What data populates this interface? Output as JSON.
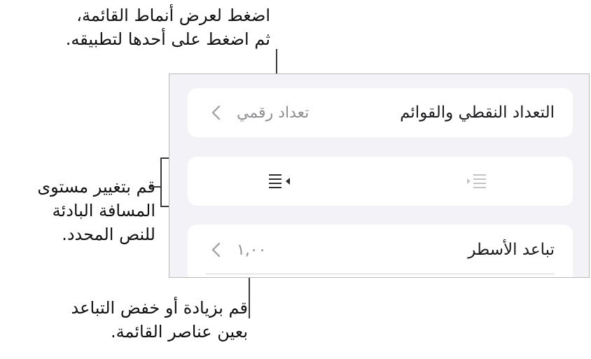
{
  "callouts": {
    "top": {
      "line1": "اضغط لعرض أنماط القائمة،",
      "line2": "ثم اضغط على أحدها لتطبيقه."
    },
    "left": {
      "line1": "قم بتغيير مستوى",
      "line2": "المسافة البادئة",
      "line3": "للنص المحدد."
    },
    "bottom": {
      "line1": "قم بزيادة أو خفض التباعد",
      "line2": "بعين عناصر القائمة."
    }
  },
  "panel": {
    "list_style": {
      "label": "التعداد النقطي والقوائم",
      "value": "تعداد رقمي",
      "icon": "chevron-left-icon"
    },
    "indent": {
      "increase_icon": "indent-increase-icon",
      "decrease_icon": "indent-decrease-icon"
    },
    "line_spacing": {
      "label": "تباعد الأسطر",
      "value": "١,٠٠",
      "icon": "chevron-left-icon"
    }
  },
  "colors": {
    "panel_bg": "#f2f2f7",
    "card_bg": "#ffffff",
    "secondary_text": "#8e8e93",
    "leader_line": "#3a3a3a"
  }
}
